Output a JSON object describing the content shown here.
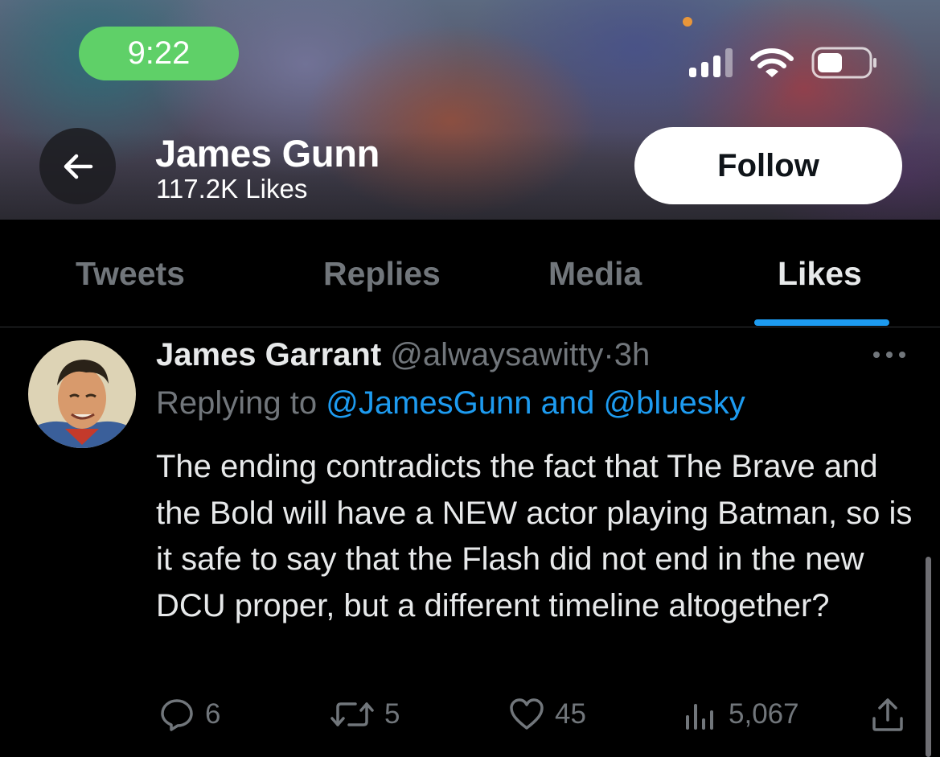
{
  "status_bar": {
    "time": "9:22"
  },
  "header": {
    "name": "James Gunn",
    "likes_count": "117.2K Likes",
    "follow_label": "Follow"
  },
  "tabs": [
    {
      "label": "Tweets",
      "active": false
    },
    {
      "label": "Replies",
      "active": false
    },
    {
      "label": "Media",
      "active": false
    },
    {
      "label": "Likes",
      "active": true
    }
  ],
  "tweet": {
    "author": "James Garrant",
    "handle": "@alwaysawitty",
    "separator": "·",
    "time_ago": "3h",
    "replying_prefix": "Replying to",
    "replying_user1": "@JamesGunn",
    "replying_and": "and",
    "replying_user2": "@bluesky",
    "text": "The ending contradicts the fact that The Brave and the Bold will have a NEW actor playing Batman, so is it safe to say that the Flash did not end in the new DCU proper, but a different timeline altogether?",
    "stats": {
      "replies": "6",
      "retweets": "5",
      "likes": "45",
      "views": "5,067"
    }
  },
  "colors": {
    "accent": "#1d9bf0",
    "time_pill": "#5fd068",
    "muted": "#71767b"
  },
  "icons": [
    "back-arrow-icon",
    "signal-icon",
    "wifi-icon",
    "battery-icon",
    "more-icon",
    "reply-icon",
    "retweet-icon",
    "like-icon",
    "views-icon",
    "share-icon"
  ]
}
